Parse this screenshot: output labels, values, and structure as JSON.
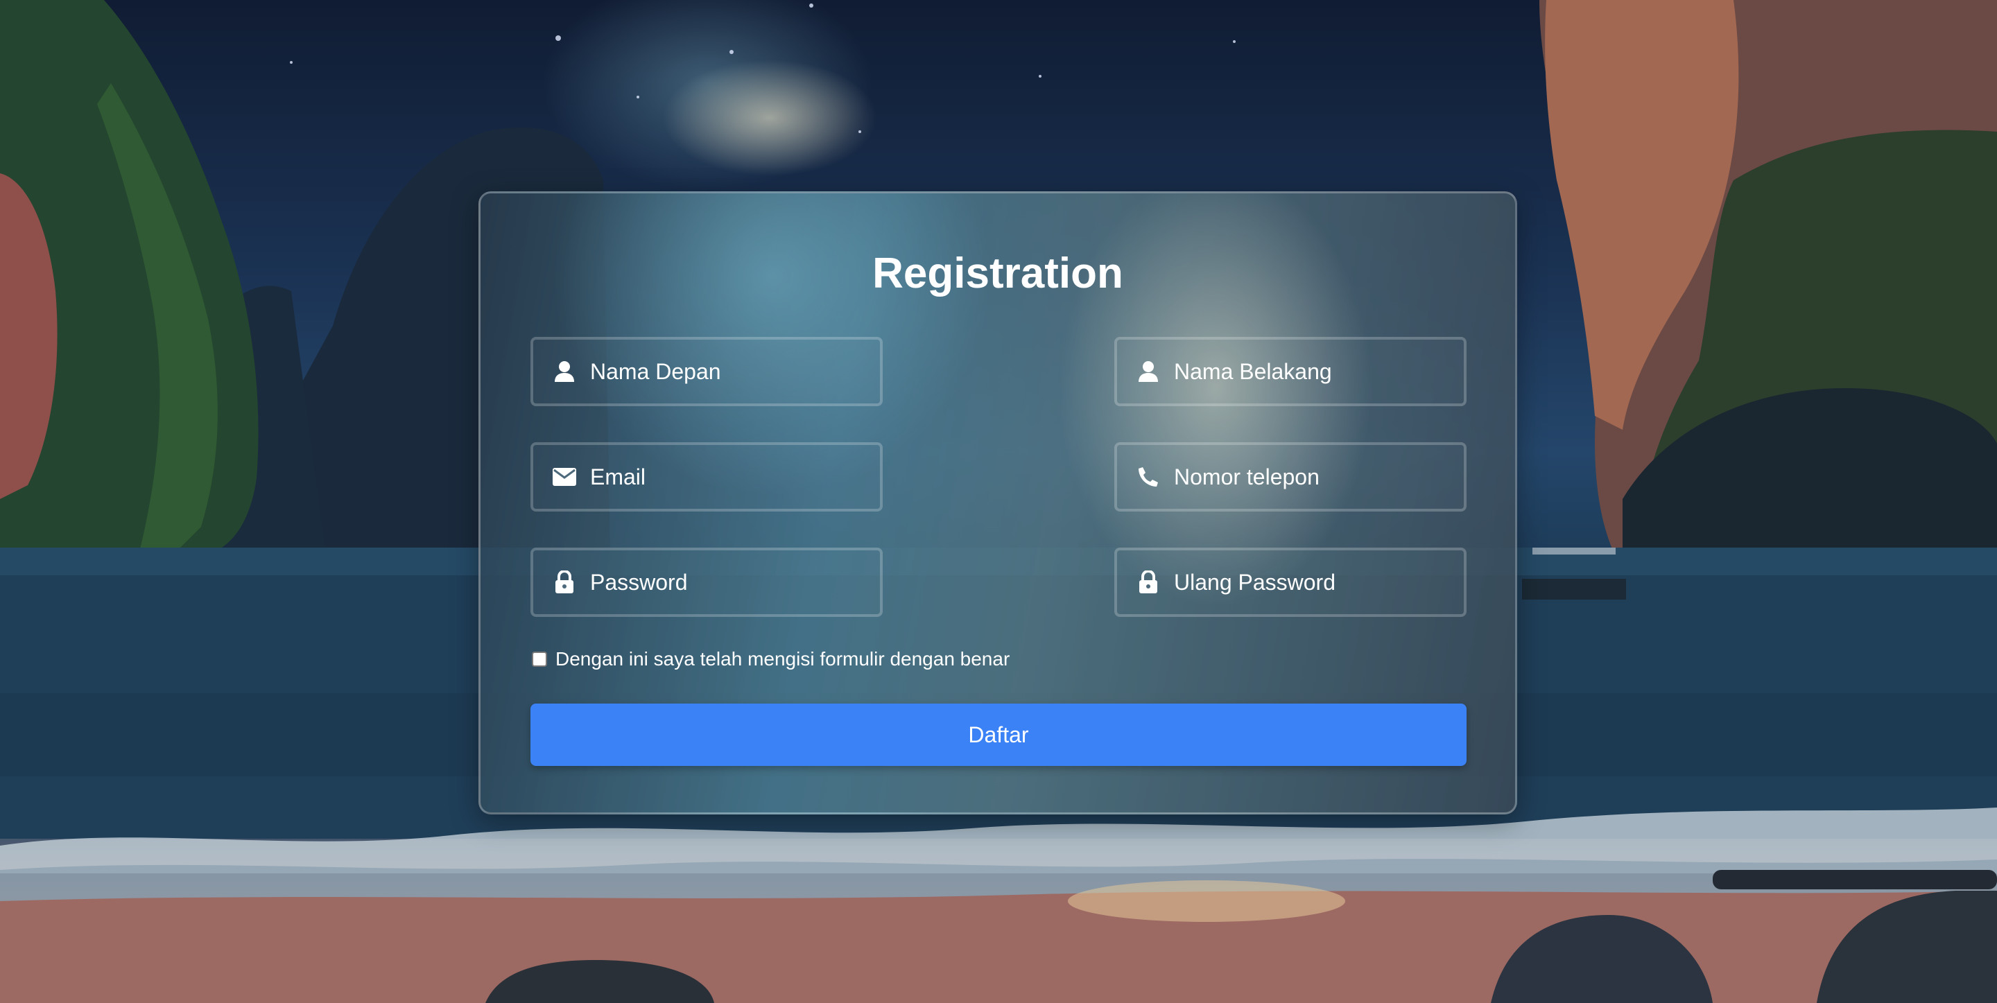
{
  "form": {
    "title": "Registration",
    "fields": [
      {
        "placeholder": "Nama Depan",
        "icon": "user-icon"
      },
      {
        "placeholder": "Nama Belakang",
        "icon": "user-icon"
      },
      {
        "placeholder": "Email",
        "icon": "envelope-icon"
      },
      {
        "placeholder": "Nomor telepon",
        "icon": "phone-icon"
      },
      {
        "placeholder": "Password",
        "icon": "lock-icon"
      },
      {
        "placeholder": "Ulang Password",
        "icon": "lock-icon"
      }
    ],
    "agree_label": "Dengan ini saya telah mengisi formulir dengan benar",
    "agree_checked": false,
    "submit_label": "Daftar"
  },
  "colors": {
    "button": "#3b82f6",
    "text": "#ffffff"
  }
}
